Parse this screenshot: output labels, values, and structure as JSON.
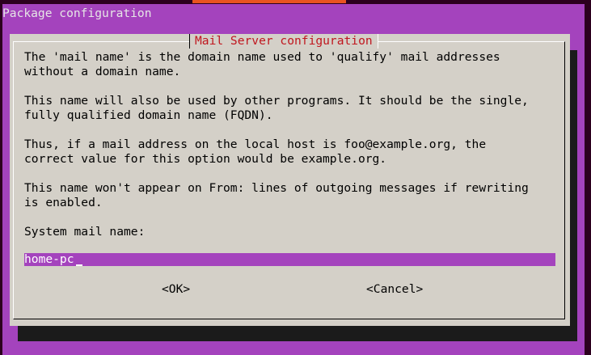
{
  "window": {
    "backtitle": "Package configuration"
  },
  "dialog": {
    "title": "Mail Server configuration",
    "paragraphs": [
      [
        "The 'mail name' is the domain name used to 'qualify' mail addresses",
        "without a domain name."
      ],
      [
        "This name will also be used by other programs. It should be the single,",
        "fully qualified domain name (FQDN)."
      ],
      [
        "Thus, if a mail address on the local host is foo@example.org, the",
        "correct value for this option would be example.org."
      ],
      [
        "This name won't appear on From: lines of outgoing messages if rewriting",
        "is enabled."
      ]
    ],
    "prompt_label": "System mail name:",
    "input_value": "home-pc",
    "ok_label": "<OK>",
    "cancel_label": "<Cancel>"
  },
  "colors": {
    "terminal_background": "#a443bd",
    "dialog_background": "#d4d0c8",
    "title_text": "#c0161e",
    "input_background": "#a443bd",
    "accent_orange": "#e95420"
  }
}
